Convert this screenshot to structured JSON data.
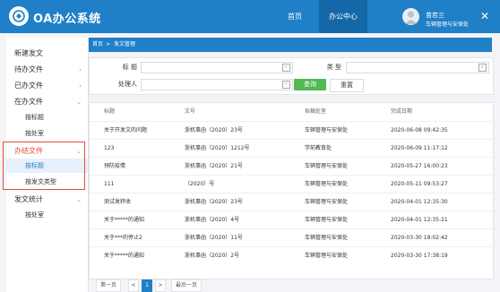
{
  "app": {
    "title": "OA办公系统"
  },
  "topnav": {
    "home": "首页",
    "office_center": "办公中心"
  },
  "user": {
    "name": "苗若兰",
    "department": "车辆管理与安保处"
  },
  "sidebar": {
    "items": [
      {
        "label": "新建发文"
      },
      {
        "label": "待办文件"
      },
      {
        "label": "已办文件"
      },
      {
        "label": "在办文件"
      },
      {
        "label": "按标题"
      },
      {
        "label": "按处室"
      },
      {
        "label": "办结文件"
      },
      {
        "label": "按标题"
      },
      {
        "label": "按发文类型"
      },
      {
        "label": "发文统计"
      },
      {
        "label": "按处室"
      }
    ]
  },
  "breadcrumb": {
    "home": "首页",
    "sep": ">",
    "current": "发文管理"
  },
  "filters": {
    "title_label": "标 题",
    "type_label": "类 型",
    "handler_label": "处理人",
    "query_button": "查询",
    "reset_button": "重置"
  },
  "table": {
    "headers": [
      "标题",
      "文号",
      "拟稿处室",
      "完成日期"
    ],
    "rows": [
      [
        "关于开发文的问题",
        "浙机事函（2020）23号",
        "车辆管理与安保处",
        "2020-06-08 09:42:35"
      ],
      [
        "123",
        "浙机事函（2020）1212号",
        "学前教育处",
        "2020-06-09 11:17:12"
      ],
      [
        "预防疫情",
        "浙机事函（2020）21号",
        "车辆管理与安保处",
        "2020-05-27 16:00:23"
      ],
      [
        "111",
        "（2020）号",
        "车辆管理与安保处",
        "2020-05-11 09:53:27"
      ],
      [
        "测试发转收",
        "浙机事函（2020）23号",
        "车辆管理与安保处",
        "2020-04-01 12:35:30"
      ],
      [
        "关于*****的通知",
        "浙机事函（2020）4号",
        "车辆管理与安保处",
        "2020-04-01 12:35:21"
      ],
      [
        "关于***的停止2",
        "浙机事函（2020）11号",
        "车辆管理与安保处",
        "2020-03-30 18:02:42"
      ],
      [
        "关于*****的通知",
        "浙机事函（2020）2号",
        "车辆管理与安保处",
        "2020-03-30 17:38:19"
      ]
    ]
  },
  "pager": {
    "first": "第一页",
    "prev": "<",
    "current": "1",
    "next": ">",
    "last": "最后一页"
  },
  "colors": {
    "primary": "#1f7fc7",
    "query_green": "#53b853",
    "active_border": "#e74c3c"
  }
}
